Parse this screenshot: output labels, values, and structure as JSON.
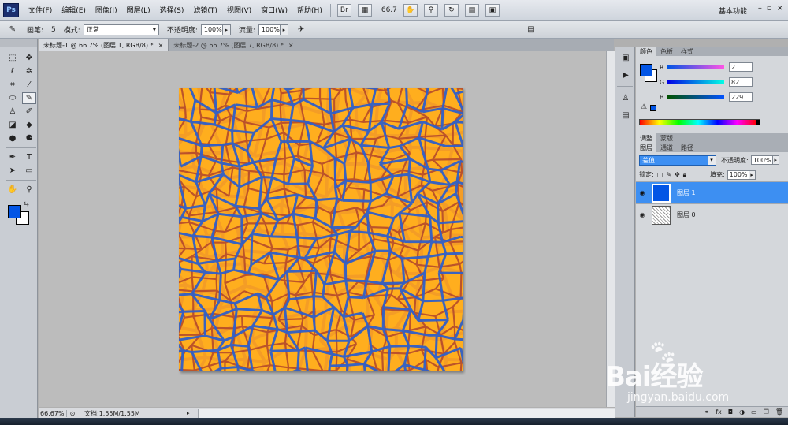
{
  "menubar": {
    "logo": "Ps",
    "items": [
      "文件(F)",
      "编辑(E)",
      "图像(I)",
      "图层(L)",
      "选择(S)",
      "滤镜(T)",
      "视图(V)",
      "窗口(W)",
      "帮助(H)"
    ],
    "bridge_btn": "Br",
    "zoom": "66.7",
    "workspace": "基本功能",
    "win_min": "–",
    "win_max": "▫",
    "win_close": "×"
  },
  "options": {
    "brush_label": "画笔:",
    "brush_size": "5",
    "mode_label": "模式:",
    "mode_value": "正常",
    "opacity_label": "不透明度:",
    "opacity_value": "100%",
    "flow_label": "流量:",
    "flow_value": "100%"
  },
  "tabs": [
    {
      "label": "未标题-1 @ 66.7% (图层 1, RGB/8) *",
      "close": "×"
    },
    {
      "label": "未标题-2 @ 66.7% (图层 7, RGB/8) *",
      "close": "×"
    }
  ],
  "status": {
    "zoom": "66.67%",
    "doc": "文档:1.55M/1.55M"
  },
  "color_panel": {
    "tabs": [
      "颜色",
      "色板",
      "样式"
    ],
    "r_label": "R",
    "r_value": "2",
    "g_label": "G",
    "g_value": "82",
    "b_label": "B",
    "b_value": "229"
  },
  "adjust_tabs": [
    "调整",
    "蒙版"
  ],
  "layers_panel": {
    "tabs": [
      "图层",
      "通道",
      "路径"
    ],
    "blend_mode": "差值",
    "opacity_label": "不透明度:",
    "opacity_value": "100%",
    "lock_label": "锁定:",
    "fill_label": "填充:",
    "fill_value": "100%",
    "layers": [
      {
        "name": "图层 1",
        "selected": true
      },
      {
        "name": "图层 0",
        "selected": false
      }
    ],
    "footer_icons": [
      "link",
      "fx",
      "mask",
      "adjust",
      "folder",
      "new",
      "trash"
    ]
  },
  "colors": {
    "foreground": "#0255e5",
    "canvas_fill": "#ffae1e",
    "crack_blue": "#2f5fc8",
    "crack_red": "#b0442c",
    "selection_blue": "#3d8ff2"
  },
  "watermark": {
    "brand": "Bai",
    "brand2": "经验",
    "url": "jingyan.baidu.com"
  }
}
